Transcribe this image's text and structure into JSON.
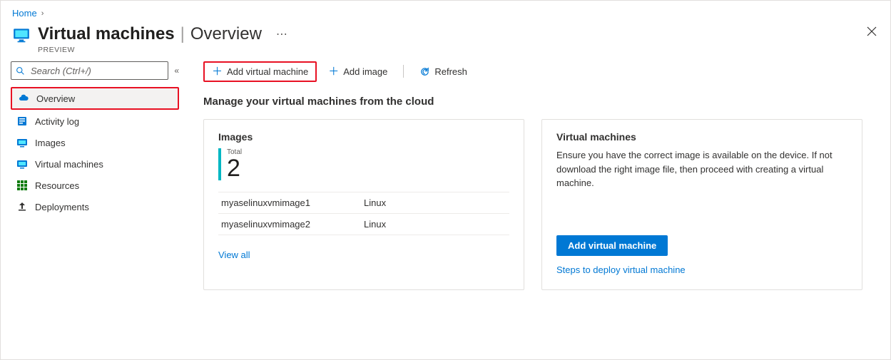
{
  "breadcrumb": {
    "home": "Home"
  },
  "header": {
    "title_strong": "Virtual machines",
    "title_light": "Overview",
    "preview": "PREVIEW"
  },
  "search": {
    "placeholder": "Search (Ctrl+/)"
  },
  "sidebar": {
    "items": [
      {
        "label": "Overview"
      },
      {
        "label": "Activity log"
      },
      {
        "label": "Images"
      },
      {
        "label": "Virtual machines"
      },
      {
        "label": "Resources"
      },
      {
        "label": "Deployments"
      }
    ]
  },
  "toolbar": {
    "add_vm": "Add virtual machine",
    "add_image": "Add image",
    "refresh": "Refresh"
  },
  "main": {
    "subtitle": "Manage your virtual machines from the cloud"
  },
  "images_card": {
    "title": "Images",
    "total_label": "Total",
    "total_value": "2",
    "rows": [
      {
        "name": "myaselinuxvmimage1",
        "os": "Linux"
      },
      {
        "name": "myaselinuxvmimage2",
        "os": "Linux"
      }
    ],
    "view_all": "View all"
  },
  "vm_card": {
    "title": "Virtual machines",
    "desc": "Ensure you have the correct image is available on the device. If not download the right image file, then proceed with creating a virtual machine.",
    "button": "Add virtual machine",
    "steps_link": "Steps to deploy virtual machine"
  }
}
